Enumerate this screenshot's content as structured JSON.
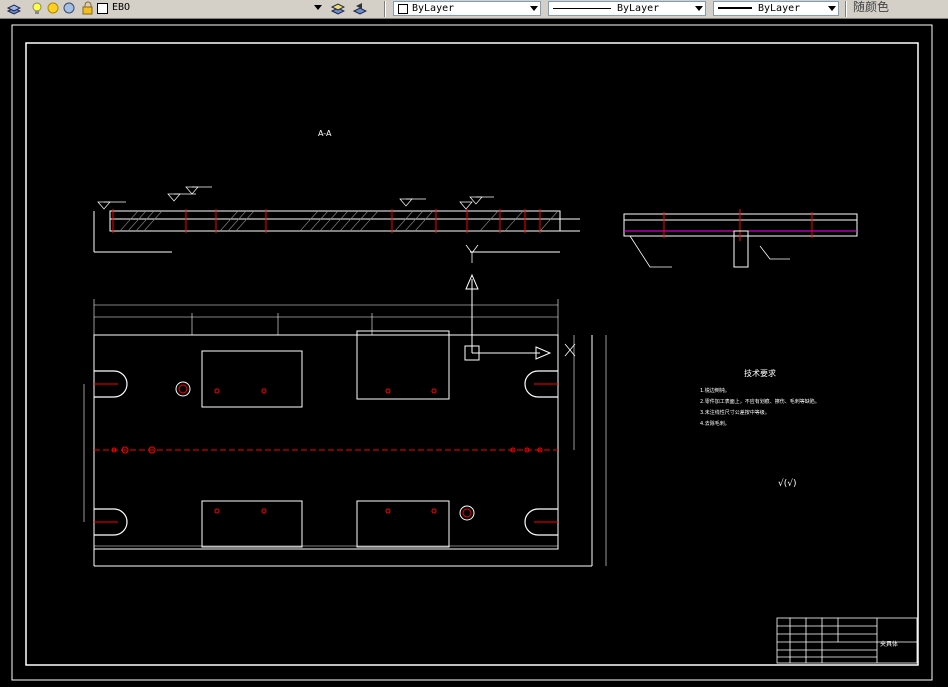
{
  "toolbar": {
    "layer_name": "EBO",
    "color_value": "ByLayer",
    "linetype_value": "ByLayer",
    "lineweight_value": "ByLayer",
    "plot_style_value": "随颜色"
  },
  "drawing": {
    "section_label": "A-A",
    "tech_title": "技术要求",
    "tech_lines": [
      "1.锐边倒钝。",
      "2.零件加工表面上，不应有划痕、擦伤、毛刺等缺陷。",
      "3.未注线性尺寸公差按中等级。",
      "4.去除毛刺。"
    ],
    "roughness_symbol": "√(√)",
    "title_block_name": "夹具体"
  },
  "colors": {
    "canvas_bg": "#000000",
    "line_white": "#ffffff",
    "hidden_red": "#ff0000",
    "center_magenta": "#ff00ff"
  }
}
